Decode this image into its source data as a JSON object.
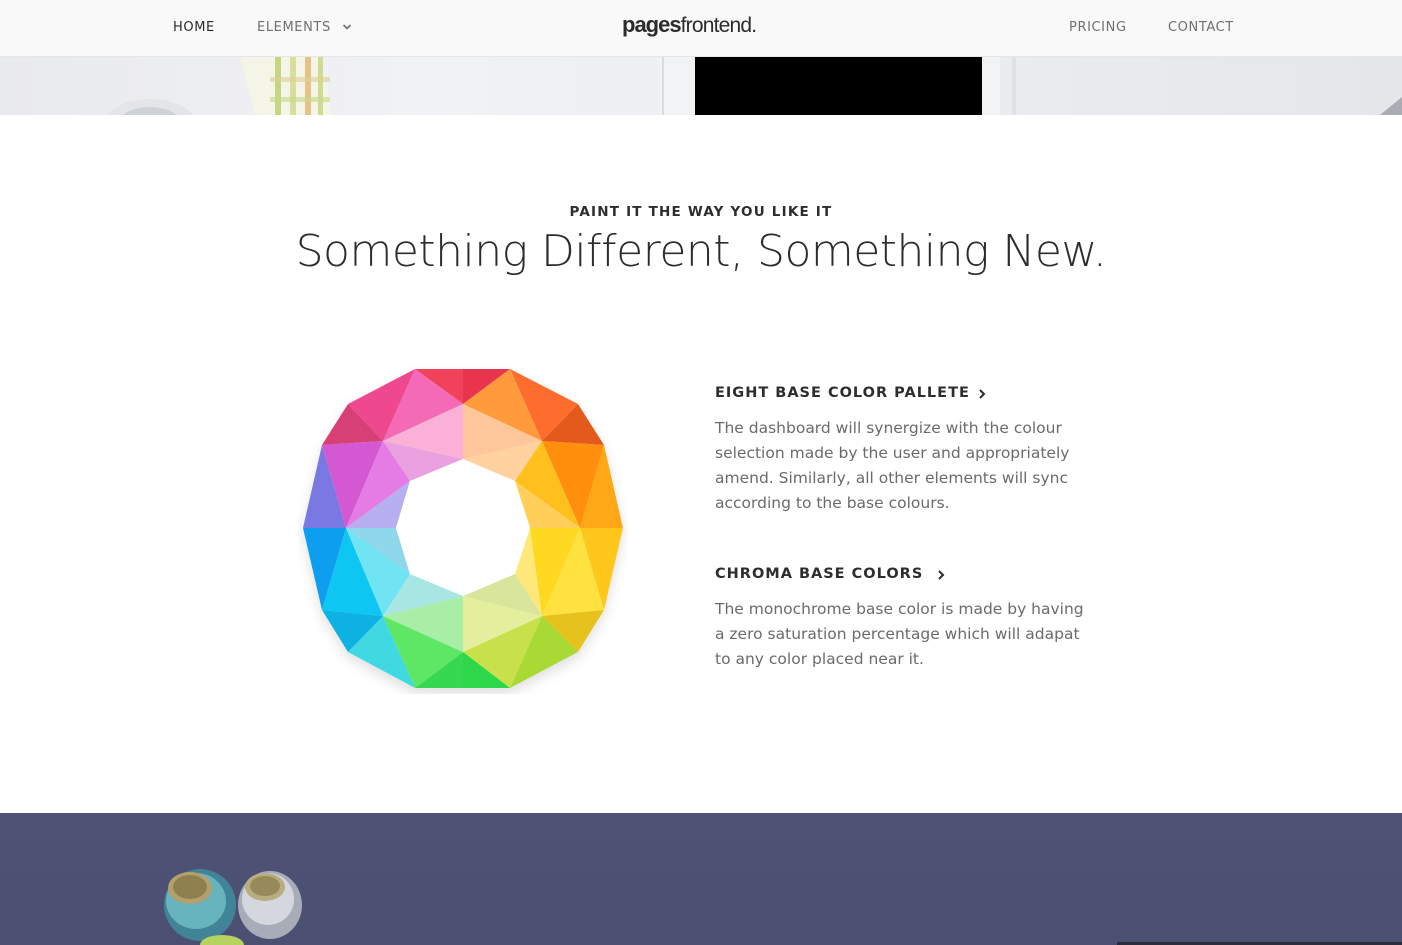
{
  "header": {
    "nav_left": [
      {
        "label": "HOME"
      },
      {
        "label": "ELEMENTS"
      }
    ],
    "logo_bold": "pages",
    "logo_light": "frontend.",
    "nav_right": [
      {
        "label": "PRICING"
      },
      {
        "label": "CONTACT"
      }
    ]
  },
  "section": {
    "eyebrow": "PAINT IT THE WAY YOU LIKE IT",
    "headline": "Something Different, Something New."
  },
  "features": [
    {
      "title": "EIGHT BASE COLOR PALLETE",
      "body": "The dashboard will synergize with the colour selection made by the user and appropriately amend. Similarly, all other elements will sync according to the base colours."
    },
    {
      "title": "CHROMA BASE COLORS",
      "body": "The monochrome base color is made by having a zero saturation percentage which will adapat to any color placed near it."
    }
  ],
  "colors": {
    "accent_dark": "#2d2d2d",
    "body_text": "#6b6b6b",
    "bottom_bg": "#4e5275"
  }
}
